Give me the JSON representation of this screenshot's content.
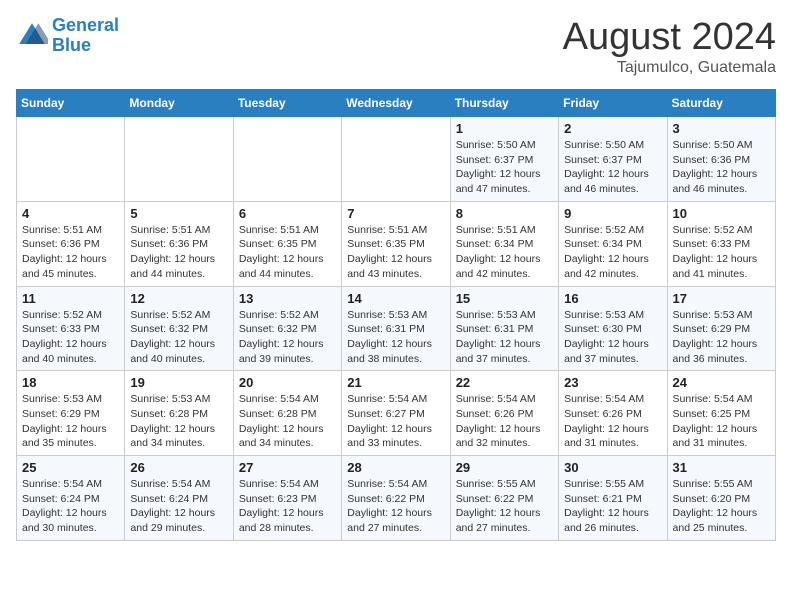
{
  "header": {
    "logo_line1": "General",
    "logo_line2": "Blue",
    "month": "August 2024",
    "location": "Tajumulco, Guatemala"
  },
  "weekdays": [
    "Sunday",
    "Monday",
    "Tuesday",
    "Wednesday",
    "Thursday",
    "Friday",
    "Saturday"
  ],
  "weeks": [
    [
      {
        "day": "",
        "info": ""
      },
      {
        "day": "",
        "info": ""
      },
      {
        "day": "",
        "info": ""
      },
      {
        "day": "",
        "info": ""
      },
      {
        "day": "1",
        "info": "Sunrise: 5:50 AM\nSunset: 6:37 PM\nDaylight: 12 hours\nand 47 minutes."
      },
      {
        "day": "2",
        "info": "Sunrise: 5:50 AM\nSunset: 6:37 PM\nDaylight: 12 hours\nand 46 minutes."
      },
      {
        "day": "3",
        "info": "Sunrise: 5:50 AM\nSunset: 6:36 PM\nDaylight: 12 hours\nand 46 minutes."
      }
    ],
    [
      {
        "day": "4",
        "info": "Sunrise: 5:51 AM\nSunset: 6:36 PM\nDaylight: 12 hours\nand 45 minutes."
      },
      {
        "day": "5",
        "info": "Sunrise: 5:51 AM\nSunset: 6:36 PM\nDaylight: 12 hours\nand 44 minutes."
      },
      {
        "day": "6",
        "info": "Sunrise: 5:51 AM\nSunset: 6:35 PM\nDaylight: 12 hours\nand 44 minutes."
      },
      {
        "day": "7",
        "info": "Sunrise: 5:51 AM\nSunset: 6:35 PM\nDaylight: 12 hours\nand 43 minutes."
      },
      {
        "day": "8",
        "info": "Sunrise: 5:51 AM\nSunset: 6:34 PM\nDaylight: 12 hours\nand 42 minutes."
      },
      {
        "day": "9",
        "info": "Sunrise: 5:52 AM\nSunset: 6:34 PM\nDaylight: 12 hours\nand 42 minutes."
      },
      {
        "day": "10",
        "info": "Sunrise: 5:52 AM\nSunset: 6:33 PM\nDaylight: 12 hours\nand 41 minutes."
      }
    ],
    [
      {
        "day": "11",
        "info": "Sunrise: 5:52 AM\nSunset: 6:33 PM\nDaylight: 12 hours\nand 40 minutes."
      },
      {
        "day": "12",
        "info": "Sunrise: 5:52 AM\nSunset: 6:32 PM\nDaylight: 12 hours\nand 40 minutes."
      },
      {
        "day": "13",
        "info": "Sunrise: 5:52 AM\nSunset: 6:32 PM\nDaylight: 12 hours\nand 39 minutes."
      },
      {
        "day": "14",
        "info": "Sunrise: 5:53 AM\nSunset: 6:31 PM\nDaylight: 12 hours\nand 38 minutes."
      },
      {
        "day": "15",
        "info": "Sunrise: 5:53 AM\nSunset: 6:31 PM\nDaylight: 12 hours\nand 37 minutes."
      },
      {
        "day": "16",
        "info": "Sunrise: 5:53 AM\nSunset: 6:30 PM\nDaylight: 12 hours\nand 37 minutes."
      },
      {
        "day": "17",
        "info": "Sunrise: 5:53 AM\nSunset: 6:29 PM\nDaylight: 12 hours\nand 36 minutes."
      }
    ],
    [
      {
        "day": "18",
        "info": "Sunrise: 5:53 AM\nSunset: 6:29 PM\nDaylight: 12 hours\nand 35 minutes."
      },
      {
        "day": "19",
        "info": "Sunrise: 5:53 AM\nSunset: 6:28 PM\nDaylight: 12 hours\nand 34 minutes."
      },
      {
        "day": "20",
        "info": "Sunrise: 5:54 AM\nSunset: 6:28 PM\nDaylight: 12 hours\nand 34 minutes."
      },
      {
        "day": "21",
        "info": "Sunrise: 5:54 AM\nSunset: 6:27 PM\nDaylight: 12 hours\nand 33 minutes."
      },
      {
        "day": "22",
        "info": "Sunrise: 5:54 AM\nSunset: 6:26 PM\nDaylight: 12 hours\nand 32 minutes."
      },
      {
        "day": "23",
        "info": "Sunrise: 5:54 AM\nSunset: 6:26 PM\nDaylight: 12 hours\nand 31 minutes."
      },
      {
        "day": "24",
        "info": "Sunrise: 5:54 AM\nSunset: 6:25 PM\nDaylight: 12 hours\nand 31 minutes."
      }
    ],
    [
      {
        "day": "25",
        "info": "Sunrise: 5:54 AM\nSunset: 6:24 PM\nDaylight: 12 hours\nand 30 minutes."
      },
      {
        "day": "26",
        "info": "Sunrise: 5:54 AM\nSunset: 6:24 PM\nDaylight: 12 hours\nand 29 minutes."
      },
      {
        "day": "27",
        "info": "Sunrise: 5:54 AM\nSunset: 6:23 PM\nDaylight: 12 hours\nand 28 minutes."
      },
      {
        "day": "28",
        "info": "Sunrise: 5:54 AM\nSunset: 6:22 PM\nDaylight: 12 hours\nand 27 minutes."
      },
      {
        "day": "29",
        "info": "Sunrise: 5:55 AM\nSunset: 6:22 PM\nDaylight: 12 hours\nand 27 minutes."
      },
      {
        "day": "30",
        "info": "Sunrise: 5:55 AM\nSunset: 6:21 PM\nDaylight: 12 hours\nand 26 minutes."
      },
      {
        "day": "31",
        "info": "Sunrise: 5:55 AM\nSunset: 6:20 PM\nDaylight: 12 hours\nand 25 minutes."
      }
    ]
  ]
}
